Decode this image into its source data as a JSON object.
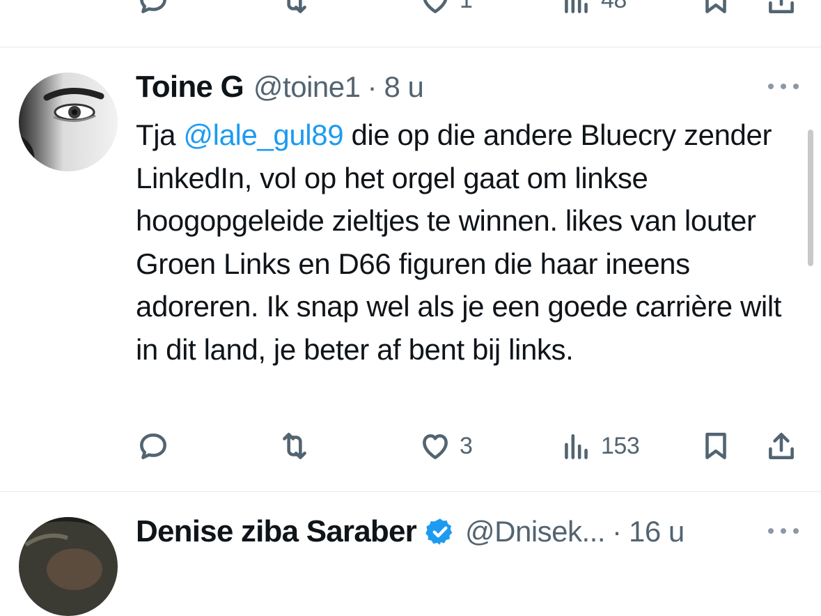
{
  "previous_tweet": {
    "actions": {
      "reply_count": "",
      "retweet_count": "",
      "like_count": "1",
      "views_count": "48"
    }
  },
  "tweet": {
    "display_name": "Toine G",
    "handle": "@toine1",
    "separator": "·",
    "time": "8 u",
    "text_prefix": "Tja ",
    "mention": "@lale_gul89",
    "text_suffix": " die op die andere Bluecry zender LinkedIn, vol op het orgel gaat om linkse hoogopgeleide zieltjes te winnen. likes van louter Groen Links en D66 figuren die haar ineens adoreren. Ik snap wel als je een goede carrière wilt in dit land, je beter af bent bij links.",
    "actions": {
      "reply_count": "",
      "retweet_count": "",
      "like_count": "3",
      "views_count": "153"
    }
  },
  "next_tweet": {
    "display_name": "Denise ziba Saraber",
    "handle": "@Dnisek...",
    "separator": "·",
    "time": "16 u",
    "verified_color": "#1d9bf0"
  },
  "colors": {
    "accent": "#1d9bf0",
    "secondary_text": "#536471",
    "divider": "#e6e8eb"
  },
  "icons": [
    "reply-icon",
    "retweet-icon",
    "like-icon",
    "views-icon",
    "bookmark-icon",
    "share-icon",
    "more-icon",
    "verified-icon"
  ]
}
